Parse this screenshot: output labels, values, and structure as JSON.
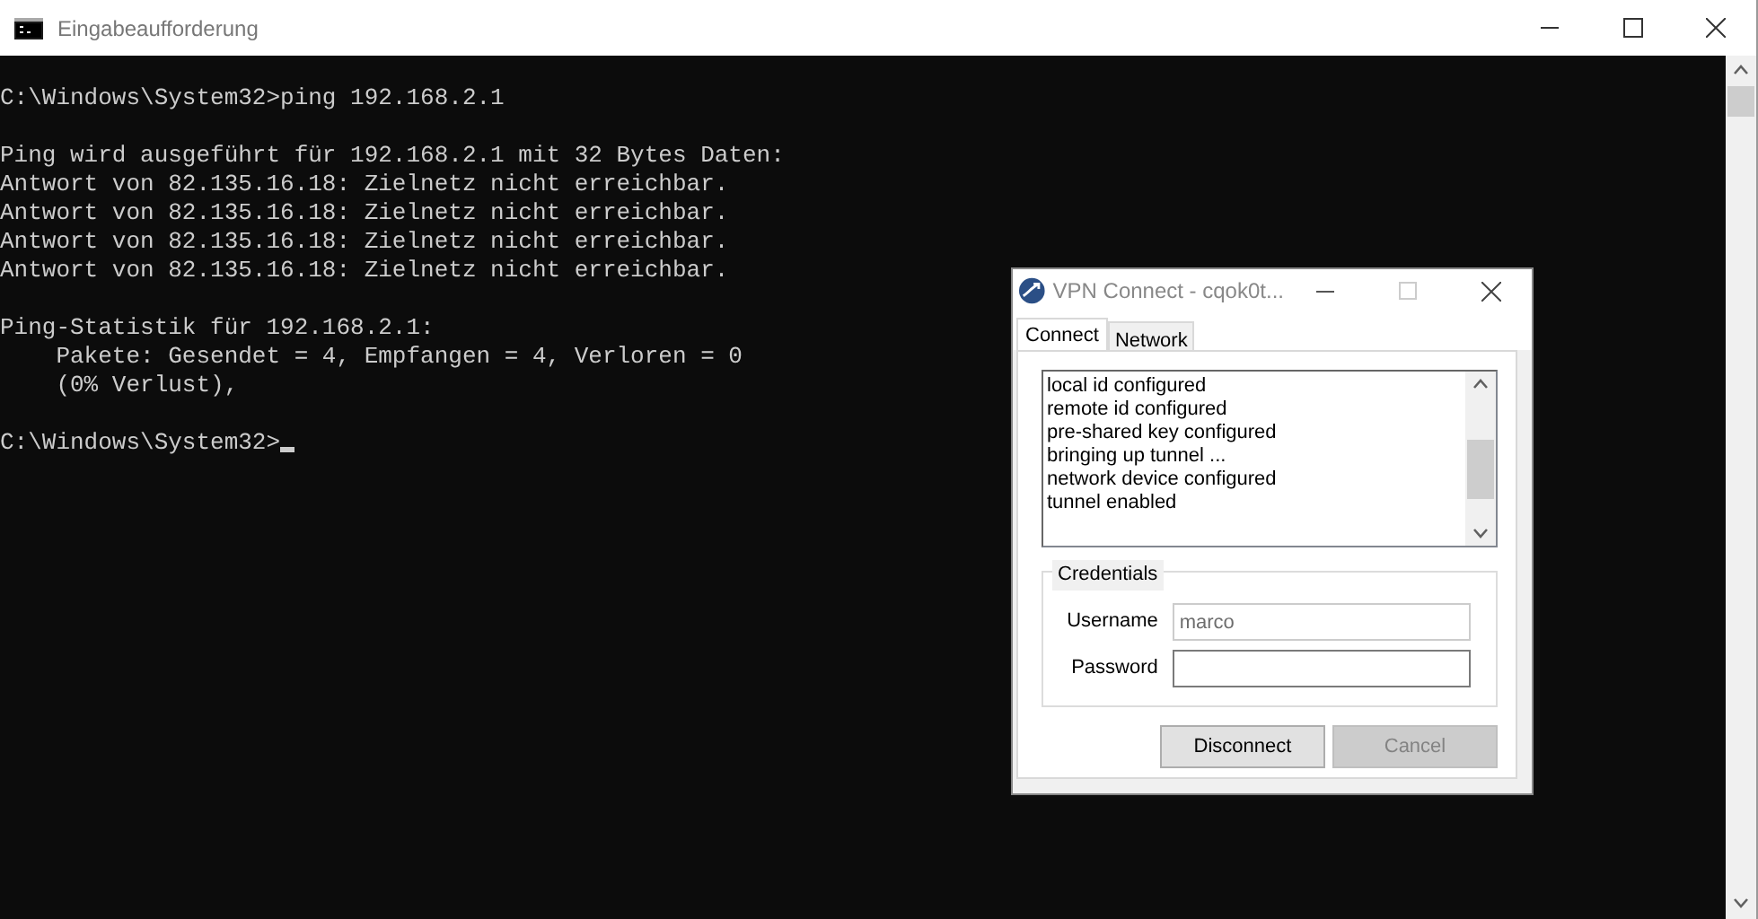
{
  "window": {
    "title": "Eingabeaufforderung"
  },
  "console": {
    "blocks": [
      {
        "lines": [
          "C:\\Windows\\System32>ping 192.168.2.1"
        ]
      },
      {
        "lines": [
          "Ping wird ausgeführt für 192.168.2.1 mit 32 Bytes Daten:",
          "Antwort von 82.135.16.18: Zielnetz nicht erreichbar.",
          "Antwort von 82.135.16.18: Zielnetz nicht erreichbar.",
          "Antwort von 82.135.16.18: Zielnetz nicht erreichbar.",
          "Antwort von 82.135.16.18: Zielnetz nicht erreichbar."
        ]
      },
      {
        "lines": [
          "Ping-Statistik für 192.168.2.1:",
          "    Pakete: Gesendet = 4, Empfangen = 4, Verloren = 0",
          "    (0% Verlust),"
        ]
      },
      {
        "lines": [
          "C:\\Windows\\System32>"
        ],
        "cursor": true
      }
    ]
  },
  "vpn_dialog": {
    "title": "VPN Connect - cqok0t...",
    "tabs": [
      {
        "label": "Connect",
        "selected": true
      },
      {
        "label": "Network",
        "selected": false
      }
    ],
    "log": [
      "local id configured",
      "remote id configured",
      "pre-shared key configured",
      "bringing up tunnel ...",
      "network device configured",
      "tunnel enabled"
    ],
    "credentials": {
      "title": "Credentials",
      "fields": [
        {
          "label": "Username",
          "value": "marco",
          "disabled": true
        },
        {
          "label": "Password",
          "disabled": false
        }
      ]
    },
    "buttons": [
      {
        "label": "Disconnect",
        "disabled": false
      },
      {
        "label": "Cancel",
        "disabled": true
      }
    ]
  }
}
